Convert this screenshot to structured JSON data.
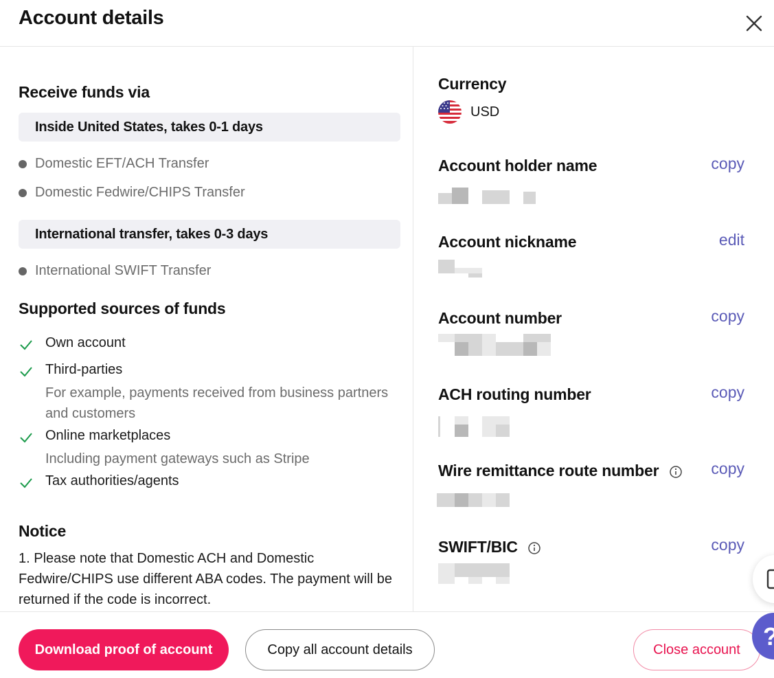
{
  "header": {
    "title": "Account details",
    "close_icon": "close-icon"
  },
  "left": {
    "receive_title": "Receive funds via",
    "domestic": {
      "band": "Inside United States, takes 0-1 days",
      "methods": [
        "Domestic EFT/ACH Transfer",
        "Domestic Fedwire/CHIPS Transfer"
      ]
    },
    "international": {
      "band": "International transfer, takes 0-3 days",
      "methods": [
        "International SWIFT Transfer"
      ]
    },
    "sources_title": "Supported sources of funds",
    "sources": [
      {
        "label": "Own account",
        "sub": ""
      },
      {
        "label": "Third-parties",
        "sub": "For example, payments received from business partners and customers"
      },
      {
        "label": "Online marketplaces",
        "sub": "Including payment gateways such as Stripe"
      },
      {
        "label": "Tax authorities/agents",
        "sub": ""
      }
    ],
    "notice_title": "Notice",
    "notice_text": "1. Please note that Domestic ACH and Domestic Fedwire/CHIPS use different ABA codes. The payment will be returned if the code is incorrect."
  },
  "right": {
    "currency_label": "Currency",
    "currency_value": "USD",
    "currency_flag": "us-flag-icon",
    "fields": [
      {
        "label": "Account holder name",
        "action": "copy"
      },
      {
        "label": "Account nickname",
        "action": "edit"
      },
      {
        "label": "Account number",
        "action": "copy"
      },
      {
        "label": "ACH routing number",
        "action": "copy"
      },
      {
        "label": "Wire remittance route number",
        "action": "copy",
        "info_icon": "info-icon"
      },
      {
        "label": "SWIFT/BIC",
        "action": "copy",
        "info_icon": "info-icon"
      }
    ]
  },
  "footer": {
    "download_label": "Download proof of account",
    "copy_all_label": "Copy all account details",
    "close_account_label": "Close account"
  },
  "widgets": {
    "help_label": "?",
    "help_icon": "help-icon",
    "side_icon": "clipboard-icon"
  },
  "colors": {
    "accent": "#f0195b",
    "link": "#5b5bb7",
    "check": "#1a9a4a",
    "help": "#5c5ccc"
  }
}
